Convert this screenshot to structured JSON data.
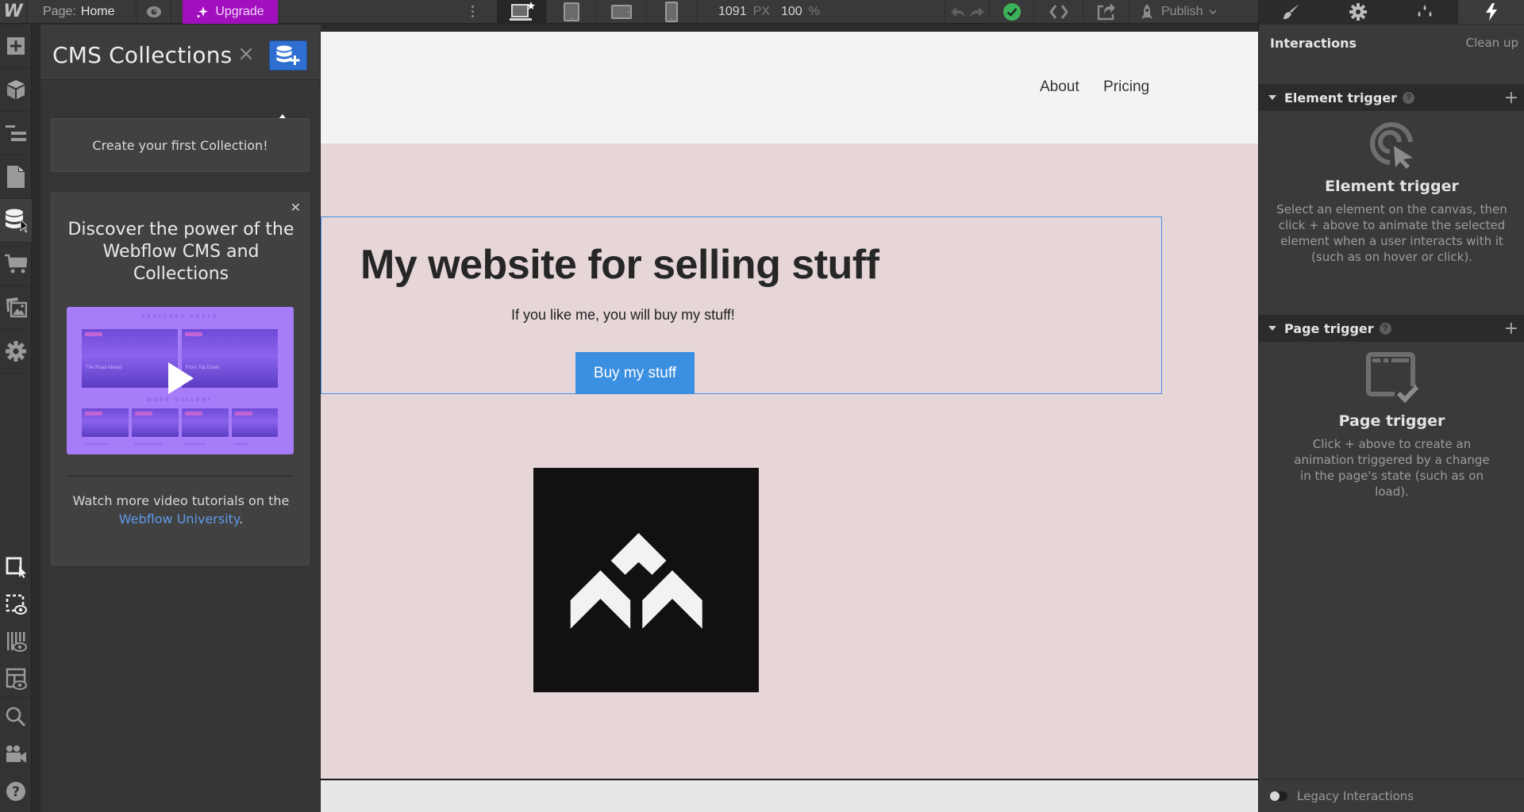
{
  "topbar": {
    "logo": "W",
    "page_label": "Page:",
    "page_value": "Home",
    "upgrade_label": "Upgrade",
    "width_value": "1091",
    "width_unit": "PX",
    "zoom_value": "100",
    "zoom_unit": "%",
    "publish_label": "Publish",
    "status": "saved",
    "colors": {
      "upgrade": "#a20fbf",
      "status_ok": "#3cb35a"
    },
    "breakpoints": [
      {
        "name": "desktop",
        "icon": "desktop-star-icon",
        "active": true
      },
      {
        "name": "tablet",
        "icon": "tablet-icon",
        "active": false
      },
      {
        "name": "mobile-landscape",
        "icon": "mobile-landscape-icon",
        "active": false
      },
      {
        "name": "mobile-portrait",
        "icon": "mobile-portrait-icon",
        "active": false
      }
    ],
    "panel_tabs": [
      {
        "name": "style",
        "icon": "brush-icon",
        "active": false
      },
      {
        "name": "settings",
        "icon": "gear-icon",
        "active": false
      },
      {
        "name": "style-manager",
        "icon": "drops-icon",
        "active": false
      },
      {
        "name": "interactions",
        "icon": "lightning-icon",
        "active": true
      }
    ]
  },
  "rail": {
    "items": [
      {
        "name": "add",
        "icon": "plus-square-icon",
        "active": false
      },
      {
        "name": "symbols",
        "icon": "cube-icon",
        "active": false
      },
      {
        "name": "navigator",
        "icon": "navigator-icon",
        "active": false
      },
      {
        "name": "pages",
        "icon": "page-icon",
        "active": false
      },
      {
        "name": "cms",
        "icon": "database-icon",
        "active": true
      },
      {
        "name": "ecommerce",
        "icon": "cart-icon",
        "active": false
      },
      {
        "name": "assets",
        "icon": "images-icon",
        "active": false
      },
      {
        "name": "project-settings",
        "icon": "gear-icon",
        "active": false
      }
    ],
    "bottom_items": [
      {
        "name": "select",
        "icon": "select-cursor-icon"
      },
      {
        "name": "preview-outline",
        "icon": "dashed-eye-icon"
      },
      {
        "name": "x-ray",
        "icon": "bars-eye-icon"
      },
      {
        "name": "layout-preview",
        "icon": "layout-eye-icon"
      },
      {
        "name": "search",
        "icon": "search-icon"
      },
      {
        "name": "video-tutorials",
        "icon": "video-camera-icon"
      },
      {
        "name": "help",
        "icon": "help-icon"
      }
    ]
  },
  "cms_panel": {
    "title": "CMS Collections",
    "create_card_text": "Create your first Collection!",
    "promo": {
      "title": "Discover the power of the Webflow CMS and Collections",
      "video": {
        "section_heading": "FEATURED POSTS",
        "section_heading_2": "MORE GALLERY",
        "cards": [
          "The Road Ahead",
          "From Top Down"
        ],
        "thumbs": [
          "The Road Ahead",
          "Self-Reflecting Pool",
          "Sunny Delivery",
          "Waterfalls"
        ]
      },
      "footer_prefix": "Watch more video tutorials on the",
      "footer_link": "Webflow University",
      "footer_suffix": "."
    }
  },
  "canvas": {
    "nav_links": [
      "About",
      "Pricing"
    ],
    "hero_title": "My website for selling stuff",
    "hero_subtitle": "If you like me, you will buy my stuff!",
    "hero_button": "Buy my stuff",
    "colors": {
      "hero_bg": "#e6d6d8",
      "nav_bg": "#f3f3f3",
      "button": "#3a8fe0",
      "selection": "#4a8ee8"
    }
  },
  "interactions": {
    "title": "Interactions",
    "clean_up_label": "Clean up",
    "element_trigger": {
      "section_label": "Element trigger",
      "empty_title": "Element trigger",
      "empty_desc": "Select an element on the canvas, then click + above to animate the selected element when a user interacts with it (such as on hover or click)."
    },
    "page_trigger": {
      "section_label": "Page trigger",
      "empty_title": "Page trigger",
      "empty_desc": "Click + above to create an animation triggered by a change in the page's state (such as on load)."
    },
    "legacy_label": "Legacy Interactions",
    "legacy_enabled": false
  }
}
